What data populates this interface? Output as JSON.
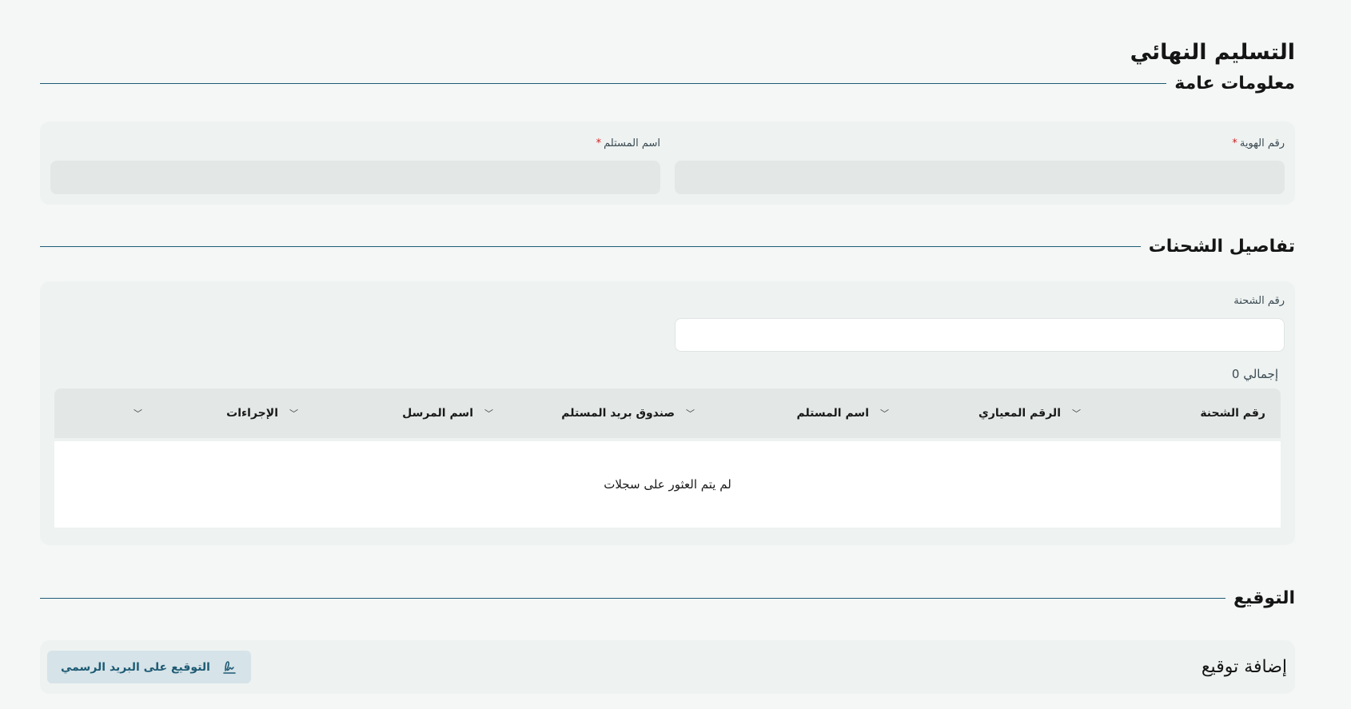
{
  "page": {
    "title": "التسليم النهائي"
  },
  "general": {
    "heading": "معلومات عامة",
    "id_label": "رقم الهوية",
    "id_value": "",
    "recipient_label": "اسم المستلم",
    "recipient_value": "",
    "required_mark": "*"
  },
  "shipments": {
    "heading": "تفاصيل الشحنات",
    "shipment_number_label": "رقم الشحنة",
    "shipment_number_value": "",
    "total_label": "إجمالي 0",
    "columns": [
      "رقم الشحنة",
      "الرقم المعياري",
      "اسم المستلم",
      "صندوق بريد المستلم",
      "اسم المرسل",
      "الإجراءات"
    ],
    "empty_message": "لم يتم العثور على سجلات"
  },
  "signature": {
    "heading": "التوقيع",
    "add_label": "إضافة توقيع",
    "button_label": "التوقيع على البريد الرسمي",
    "button_icon": "signature-icon"
  },
  "colors": {
    "accent": "#1e5b74",
    "required": "#d11f1f",
    "background": "#f4f7f6"
  }
}
